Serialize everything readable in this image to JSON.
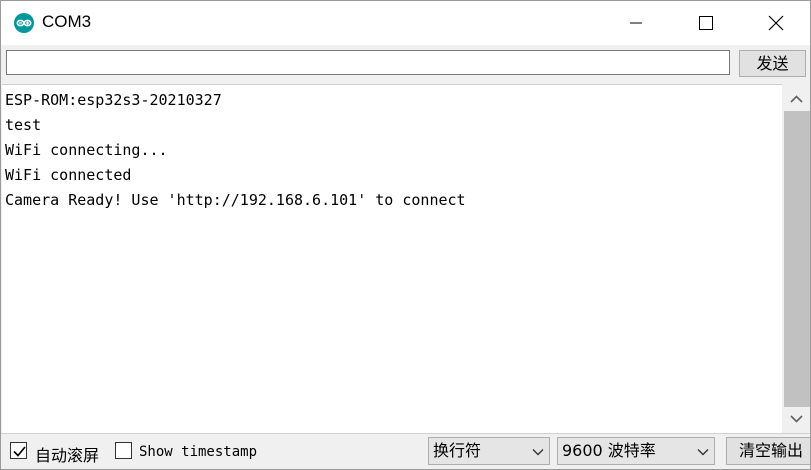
{
  "window": {
    "title": "COM3"
  },
  "send": {
    "input_value": "",
    "button_label": "发送"
  },
  "output": {
    "lines": [
      "ESP-ROM:esp32s3-20210327",
      "test",
      "WiFi connecting...",
      "WiFi connected",
      "Camera Ready! Use 'http://192.168.6.101' to connect"
    ]
  },
  "bottom": {
    "autoscroll": {
      "label": "自动滚屏",
      "checked": true
    },
    "timestamp": {
      "label": "Show timestamp",
      "checked": false
    },
    "line_ending": "换行符",
    "baud_rate": "9600 波特率",
    "clear_label": "清空输出"
  },
  "colors": {
    "logo": "#00979c",
    "scroll_thumb": "#c1c1c1"
  }
}
